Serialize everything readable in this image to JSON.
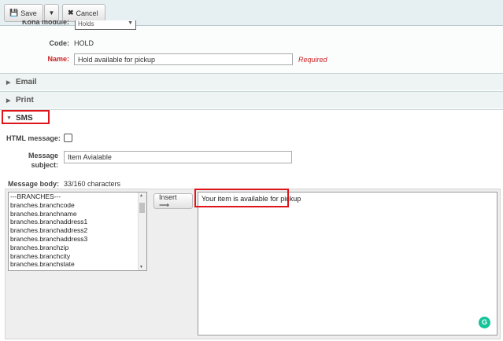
{
  "toolbar": {
    "save_label": "Save",
    "cancel_label": "Cancel"
  },
  "notice": {
    "module_label": "Koha module:",
    "module_value": "Holds",
    "code_label": "Code:",
    "code_value": "HOLD",
    "name_label": "Name:",
    "name_value": "Hold available for pickup",
    "required_text": "Required"
  },
  "sections": {
    "email": "Email",
    "print": "Print",
    "sms": "SMS"
  },
  "sms": {
    "html_message_label": "HTML message:",
    "subject_label_line1": "Message",
    "subject_label_line2": "subject:",
    "subject_value": "Item Avialable",
    "body_label": "Message body:",
    "char_count": "33/160 characters",
    "insert_label": "Insert ⟶",
    "body_value": "Your item is available for pickup",
    "fields": [
      "---BRANCHES---",
      "branches.branchcode",
      "branches.branchname",
      "branches.branchaddress1",
      "branches.branchaddress2",
      "branches.branchaddress3",
      "branches.branchzip",
      "branches.branchcity",
      "branches.branchstate"
    ]
  },
  "colors": {
    "required": "#cc2222",
    "highlight": "#e0141b",
    "grammarly": "#15c39a"
  },
  "icons": {
    "save": "floppy-disk-icon",
    "dropdown": "caret-down-icon",
    "cancel": "close-icon",
    "grammarly": "grammarly-icon"
  }
}
